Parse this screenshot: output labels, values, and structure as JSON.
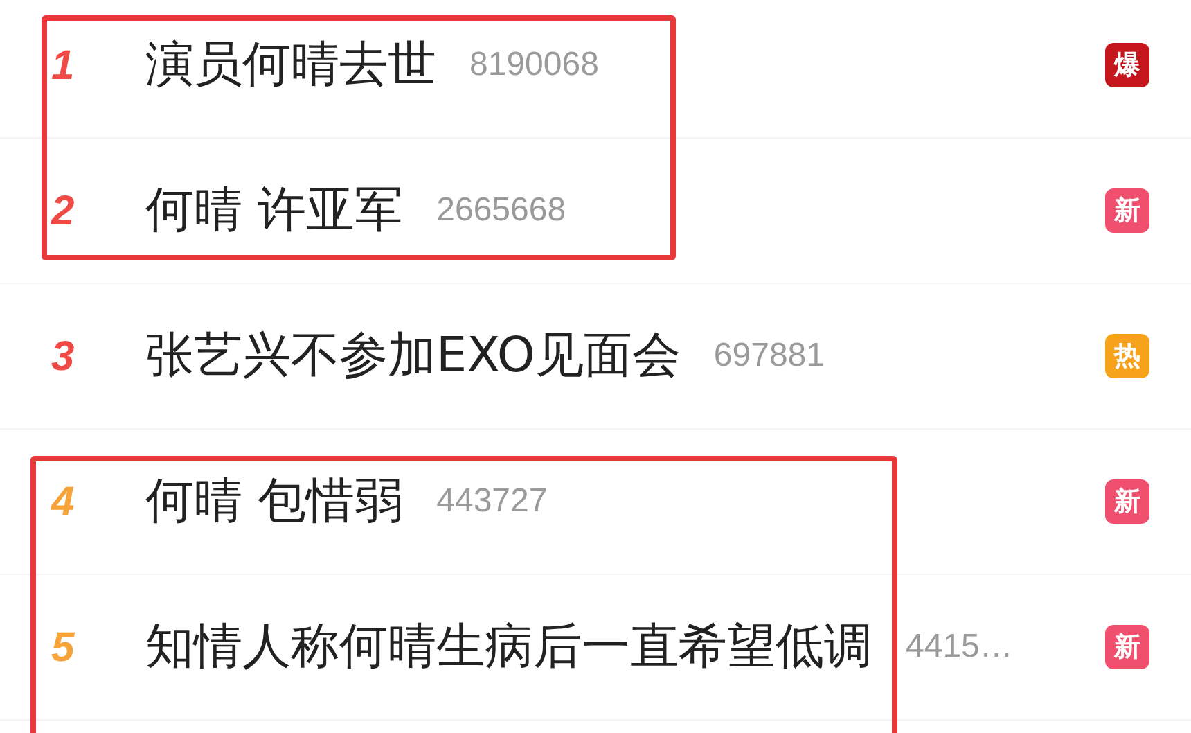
{
  "sections": [
    {
      "boxed": true,
      "items": [
        {
          "rank": {
            "text": "1",
            "color": "#f04a46"
          },
          "title": "演员何晴去世",
          "count": "8190068",
          "badge": {
            "text": "爆",
            "color": "#c4161c"
          }
        },
        {
          "rank": {
            "text": "2",
            "color": "#f04a46"
          },
          "title": "何晴 许亚军",
          "count": "2665668",
          "badge": {
            "text": "新",
            "color": "#f0506e"
          }
        }
      ]
    },
    {
      "boxed": false,
      "items": [
        {
          "rank": {
            "text": "3",
            "color": "#f04a46"
          },
          "title": "张艺兴不参加EXO见面会",
          "count": "697881",
          "badge": {
            "text": "热",
            "color": "#f7a21b"
          }
        }
      ]
    },
    {
      "boxed": true,
      "items": [
        {
          "rank": {
            "text": "4",
            "color": "#f6a33a"
          },
          "title": "何晴 包惜弱",
          "count": "443727",
          "badge": {
            "text": "新",
            "color": "#f0506e"
          }
        },
        {
          "rank": {
            "text": "5",
            "color": "#f6a33a"
          },
          "title": "知情人称何晴生病后一直希望低调",
          "count": "4415…",
          "badge": {
            "text": "新",
            "color": "#f0506e"
          }
        }
      ]
    }
  ]
}
